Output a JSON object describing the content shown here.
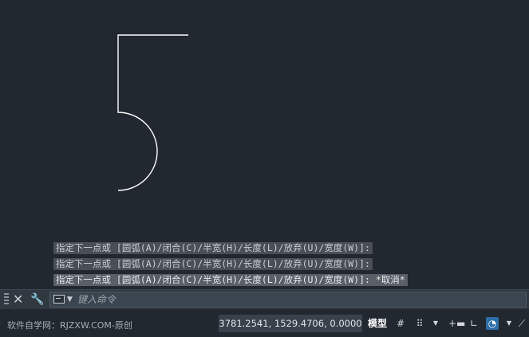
{
  "command_history": [
    "指定下一点或 [圆弧(A)/闭合(C)/半宽(H)/长度(L)/放弃(U)/宽度(W)]:",
    "指定下一点或 [圆弧(A)/闭合(C)/半宽(H)/长度(L)/放弃(U)/宽度(W)]:",
    "指定下一点或 [圆弧(A)/闭合(C)/半宽(H)/长度(L)/放弃(U)/宽度(W)]: *取消*"
  ],
  "command_line": {
    "placeholder": "键入命令"
  },
  "status_bar": {
    "watermark": "软件自学网：RJZXW.COM-原创",
    "coordinates": "3781.2541, 1529.4706, 0.0000",
    "model_label": "模型"
  },
  "colors": {
    "background": "#212830",
    "drawing_line": "#ffffff",
    "active_toggle": "#2f6ea8"
  }
}
